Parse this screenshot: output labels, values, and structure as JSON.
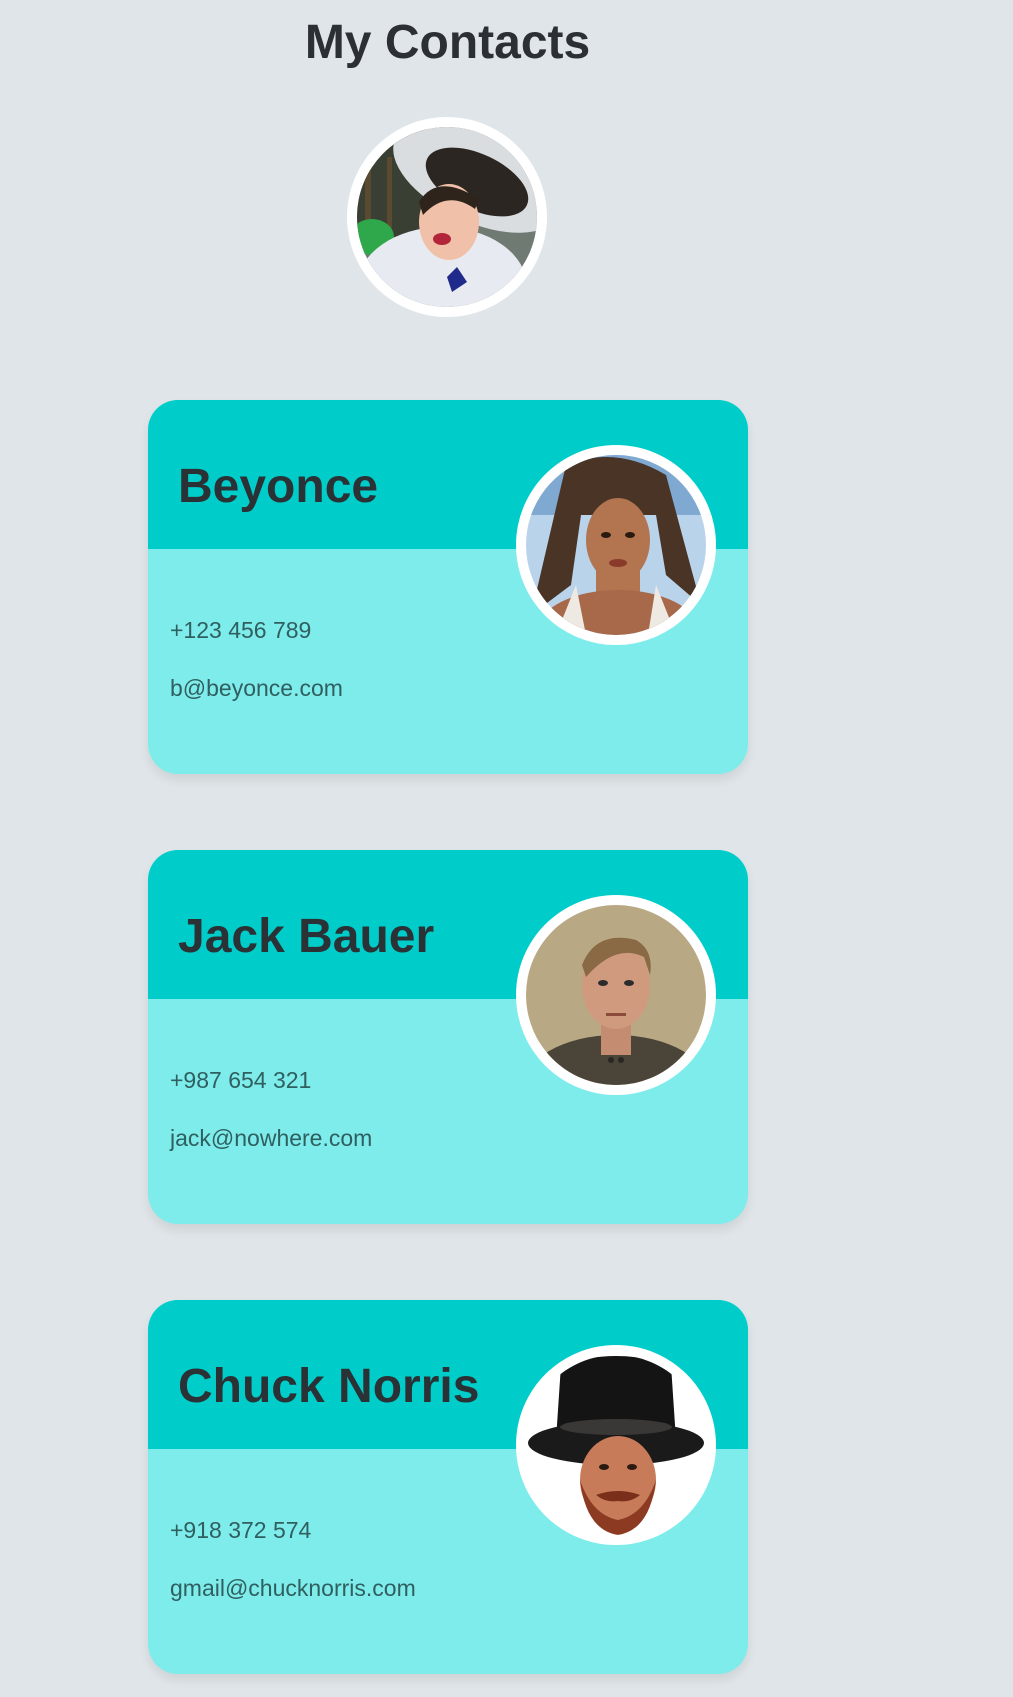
{
  "page": {
    "title": "My Contacts"
  },
  "colors": {
    "background": "#dfe5e8",
    "card_header": "#00cdca",
    "card_body": "#7fecec",
    "heading_text": "#2c3034",
    "detail_text": "#2f5f5f"
  },
  "contacts": [
    {
      "name": "Beyonce",
      "phone": "+123 456 789",
      "email": "b@beyonce.com"
    },
    {
      "name": "Jack Bauer",
      "phone": "+987 654 321",
      "email": "jack@nowhere.com"
    },
    {
      "name": "Chuck Norris",
      "phone": "+918 372 574",
      "email": "gmail@chucknorris.com"
    }
  ]
}
